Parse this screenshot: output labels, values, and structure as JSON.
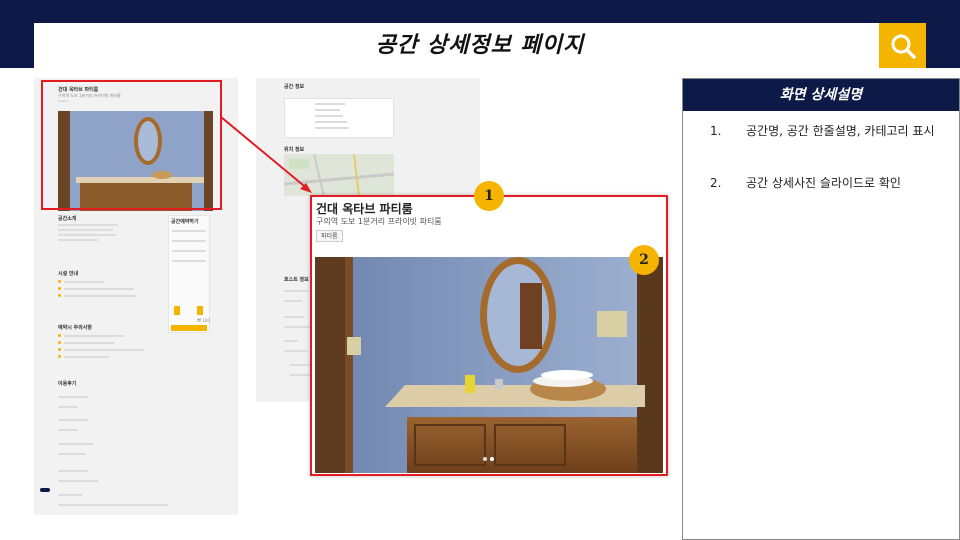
{
  "header": {
    "title": "공간 상세정보 페이지",
    "search_icon": "search-icon",
    "accent_color": "#f4b400",
    "band_color": "#0d1a47"
  },
  "mock_left": {
    "space_name": "건대 옥타브 파티룸",
    "space_sub": "구의역 도보 1분거리 프라이빗 파티룸",
    "section_intro": "공간소개",
    "section_facility": "시설 안내",
    "section_notice": "예약시 주의사항",
    "section_review": "이용후기",
    "reserve_label": "공간예약하기",
    "reserve_button": "예약하기",
    "price_label": "₩ 100"
  },
  "mock_mid": {
    "section_info": "공간 정보",
    "section_map": "위치 정보",
    "section_host": "호스트 정보"
  },
  "zoom": {
    "space_name": "건대 옥타브 파티룸",
    "space_sub": "구의역 도보 1분거리 프라이빗 파티룸",
    "category": "파티룸"
  },
  "badges": [
    "1",
    "2"
  ],
  "description": {
    "header": "화면 상세설명",
    "items": [
      {
        "num": "1.",
        "text": "공간명, 공간 한줄설명, 카테고리 표시"
      },
      {
        "num": "2.",
        "text": "공간 상세사진 슬라이드로 확인"
      }
    ]
  }
}
